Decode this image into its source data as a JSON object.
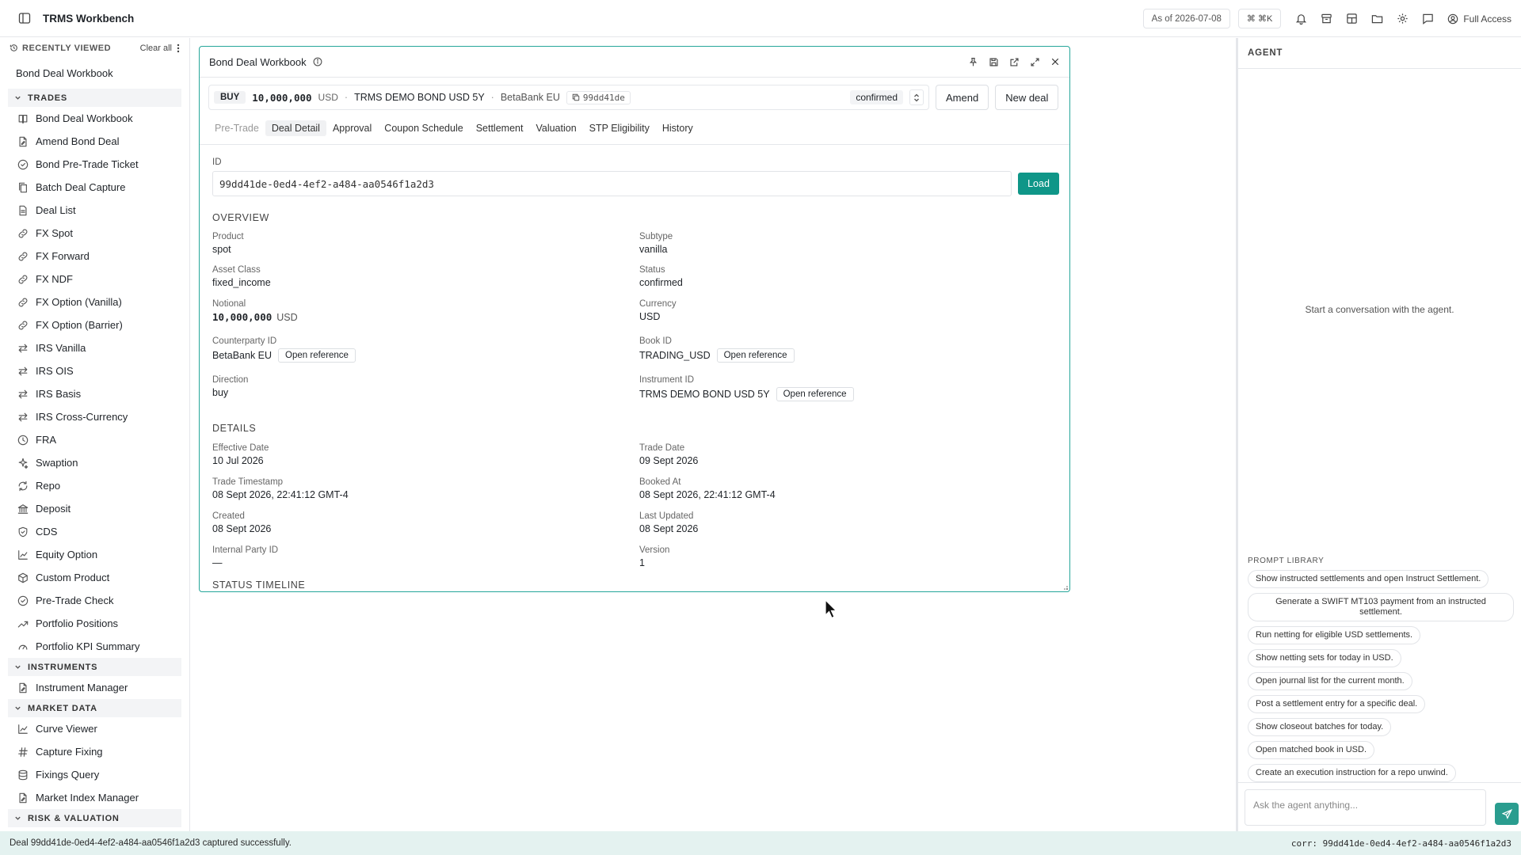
{
  "app": {
    "title": "TRMS Workbench",
    "as_of": "As of 2026-07-08",
    "cmdk": "⌘ ⌘K",
    "access": "Full Access"
  },
  "sidebar": {
    "recent_heading": "RECENTLY VIEWED",
    "clear_all": "Clear all",
    "recent_items": [
      "Bond Deal Workbook"
    ],
    "sections": [
      {
        "title": "TRADES",
        "items": [
          {
            "label": "Bond Deal Workbook",
            "icon": "book-icon"
          },
          {
            "label": "Amend Bond Deal",
            "icon": "file-edit-icon"
          },
          {
            "label": "Bond Pre-Trade Ticket",
            "icon": "check-circle-icon"
          },
          {
            "label": "Batch Deal Capture",
            "icon": "file-stack-icon"
          },
          {
            "label": "Deal List",
            "icon": "document-icon"
          },
          {
            "label": "FX Spot",
            "icon": "link-icon"
          },
          {
            "label": "FX Forward",
            "icon": "link-icon"
          },
          {
            "label": "FX NDF",
            "icon": "link-icon"
          },
          {
            "label": "FX Option (Vanilla)",
            "icon": "link-icon"
          },
          {
            "label": "FX Option (Barrier)",
            "icon": "link-icon"
          },
          {
            "label": "IRS Vanilla",
            "icon": "swap-arrows-icon"
          },
          {
            "label": "IRS OIS",
            "icon": "swap-arrows-icon"
          },
          {
            "label": "IRS Basis",
            "icon": "swap-arrows-icon"
          },
          {
            "label": "IRS Cross-Currency",
            "icon": "swap-arrows-icon"
          },
          {
            "label": "FRA",
            "icon": "clock-icon"
          },
          {
            "label": "Swaption",
            "icon": "sparkle-icon"
          },
          {
            "label": "Repo",
            "icon": "refresh-icon"
          },
          {
            "label": "Deposit",
            "icon": "bank-icon"
          },
          {
            "label": "CDS",
            "icon": "shield-icon"
          },
          {
            "label": "Equity Option",
            "icon": "line-chart-icon"
          },
          {
            "label": "Custom Product",
            "icon": "cube-icon"
          },
          {
            "label": "Pre-Trade Check",
            "icon": "check-circle-icon"
          },
          {
            "label": "Portfolio Positions",
            "icon": "trend-up-icon"
          },
          {
            "label": "Portfolio KPI Summary",
            "icon": "gauge-icon"
          }
        ]
      },
      {
        "title": "INSTRUMENTS",
        "items": [
          {
            "label": "Instrument Manager",
            "icon": "file-edit-icon"
          }
        ]
      },
      {
        "title": "MARKET DATA",
        "items": [
          {
            "label": "Curve Viewer",
            "icon": "line-chart-icon"
          },
          {
            "label": "Capture Fixing",
            "icon": "hash-icon"
          },
          {
            "label": "Fixings Query",
            "icon": "database-icon"
          },
          {
            "label": "Market Index Manager",
            "icon": "file-edit-icon"
          }
        ]
      },
      {
        "title": "RISK & VALUATION",
        "items": []
      }
    ]
  },
  "panel": {
    "title": "Bond Deal Workbook",
    "summary": {
      "direction": "BUY",
      "amount": "10,000,000",
      "currency": "USD",
      "instrument": "TRMS DEMO BOND USD 5Y",
      "counterparty": "BetaBank EU",
      "short_id": "99dd41de",
      "status": "confirmed",
      "amend_label": "Amend",
      "new_deal_label": "New deal"
    },
    "tabs": [
      {
        "label": "Pre-Trade",
        "state": "muted"
      },
      {
        "label": "Deal Detail",
        "state": "active"
      },
      {
        "label": "Approval",
        "state": ""
      },
      {
        "label": "Coupon Schedule",
        "state": ""
      },
      {
        "label": "Settlement",
        "state": ""
      },
      {
        "label": "Valuation",
        "state": ""
      },
      {
        "label": "STP Eligibility",
        "state": ""
      },
      {
        "label": "History",
        "state": ""
      }
    ],
    "id_label": "ID",
    "id_value": "99dd41de-0ed4-4ef2-a484-aa0546f1a2d3",
    "load_label": "Load",
    "overview_title": "OVERVIEW",
    "overview": {
      "product_label": "Product",
      "product": "spot",
      "subtype_label": "Subtype",
      "subtype": "vanilla",
      "asset_class_label": "Asset Class",
      "asset_class": "fixed_income",
      "status_label": "Status",
      "status": "confirmed",
      "notional_label": "Notional",
      "notional_amount": "10,000,000",
      "notional_ccy": "USD",
      "currency_label": "Currency",
      "currency": "USD",
      "counterparty_label": "Counterparty ID",
      "counterparty": "BetaBank EU",
      "book_label": "Book ID",
      "book": "TRADING_USD",
      "direction_label": "Direction",
      "direction": "buy",
      "instrument_label": "Instrument ID",
      "instrument": "TRMS DEMO BOND USD 5Y",
      "open_ref": "Open reference"
    },
    "details_title": "DETAILS",
    "details": {
      "effective_label": "Effective Date",
      "effective": "10 Jul 2026",
      "trade_date_label": "Trade Date",
      "trade_date": "09 Sept 2026",
      "trade_ts_label": "Trade Timestamp",
      "trade_ts": "08 Sept 2026, 22:41:12 GMT-4",
      "booked_label": "Booked At",
      "booked": "08 Sept 2026, 22:41:12 GMT-4",
      "created_label": "Created",
      "created": "08 Sept 2026",
      "updated_label": "Last Updated",
      "updated": "08 Sept 2026",
      "internal_label": "Internal Party ID",
      "internal": "—",
      "version_label": "Version",
      "version": "1"
    },
    "timeline_title": "STATUS TIMELINE"
  },
  "agent": {
    "title": "AGENT",
    "empty": "Start a conversation with the agent.",
    "library_title": "PROMPT LIBRARY",
    "prompts": [
      "Show instructed settlements and open Instruct Settlement.",
      "Generate a SWIFT MT103 payment from an instructed settlement.",
      "Run netting for eligible USD settlements.",
      "Show netting sets for today in USD.",
      "Open journal list for the current month.",
      "Post a settlement entry for a specific deal.",
      "Show closeout batches for today.",
      "Open matched book in USD.",
      "Create an execution instruction for a repo unwind."
    ],
    "input_placeholder": "Ask the agent anything..."
  },
  "footer": {
    "message": "Deal 99dd41de-0ed4-4ef2-a484-aa0546f1a2d3 captured successfully.",
    "corr": "corr: 99dd41de-0ed4-4ef2-a484-aa0546f1a2d3"
  },
  "colors": {
    "accent": "#0f9688",
    "footer_bg": "#e4f2f0"
  }
}
